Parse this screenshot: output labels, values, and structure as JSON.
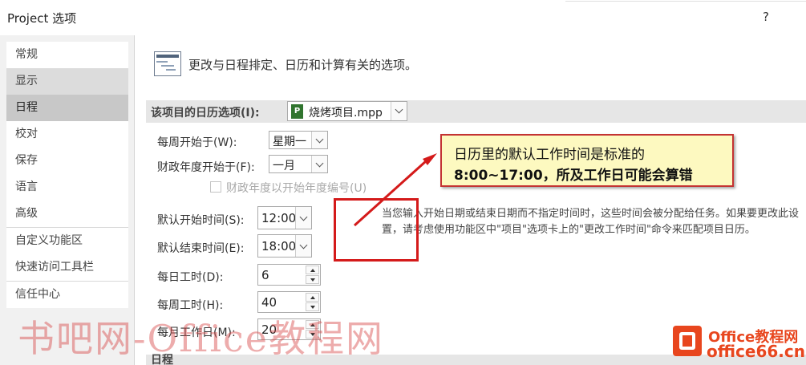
{
  "window": {
    "title": "Project 选项",
    "help": "?"
  },
  "sidebar": {
    "items": [
      {
        "label": "常规"
      },
      {
        "label": "显示"
      },
      {
        "label": "日程"
      },
      {
        "label": "校对"
      },
      {
        "label": "保存"
      },
      {
        "label": "语言"
      },
      {
        "label": "高级"
      },
      {
        "label": "自定义功能区"
      },
      {
        "label": "快速访问工具栏"
      },
      {
        "label": "信任中心"
      }
    ],
    "active_index": 2
  },
  "main": {
    "header": "更改与日程排定、日历和计算有关的选项。",
    "calendar_section": {
      "label": "该项目的日历选项(I):",
      "project_file": "烧烤项目.mpp",
      "project_icon": "P"
    },
    "fields": {
      "week_start_label": "每周开始于(W):",
      "week_start_value": "星期一",
      "fiscal_start_label": "财政年度开始于(F):",
      "fiscal_start_value": "一月",
      "fiscal_numbering_label": "财政年度以开始年度编号(U)",
      "default_start_label": "默认开始时间(S):",
      "default_start_value": "12:00",
      "default_end_label": "默认结束时间(E):",
      "default_end_value": "18:00",
      "hours_per_day_label": "每日工时(D):",
      "hours_per_day_value": "6",
      "hours_per_week_label": "每周工时(H):",
      "hours_per_week_value": "40",
      "days_per_month_label": "每月工作日(M):",
      "days_per_month_value": "20"
    },
    "note": "当您输入开始日期或结束日期而不指定时间时，这些时间会被分配给任务。如果要更改此设置，请考虑使用功能区中\"项目\"选项卡上的\"更改工作时间\"命令来匹配项目日历。",
    "next_section": "日程"
  },
  "annotation": {
    "line1": "日历里的默认工作时间是标准的",
    "line2": "8:00~17:00，所及工作日可能会算错",
    "color": "#d41a1a"
  },
  "watermark": "书吧网-Office教程网",
  "logo": {
    "line1": "Office教程网",
    "line2": "office66.cn"
  }
}
